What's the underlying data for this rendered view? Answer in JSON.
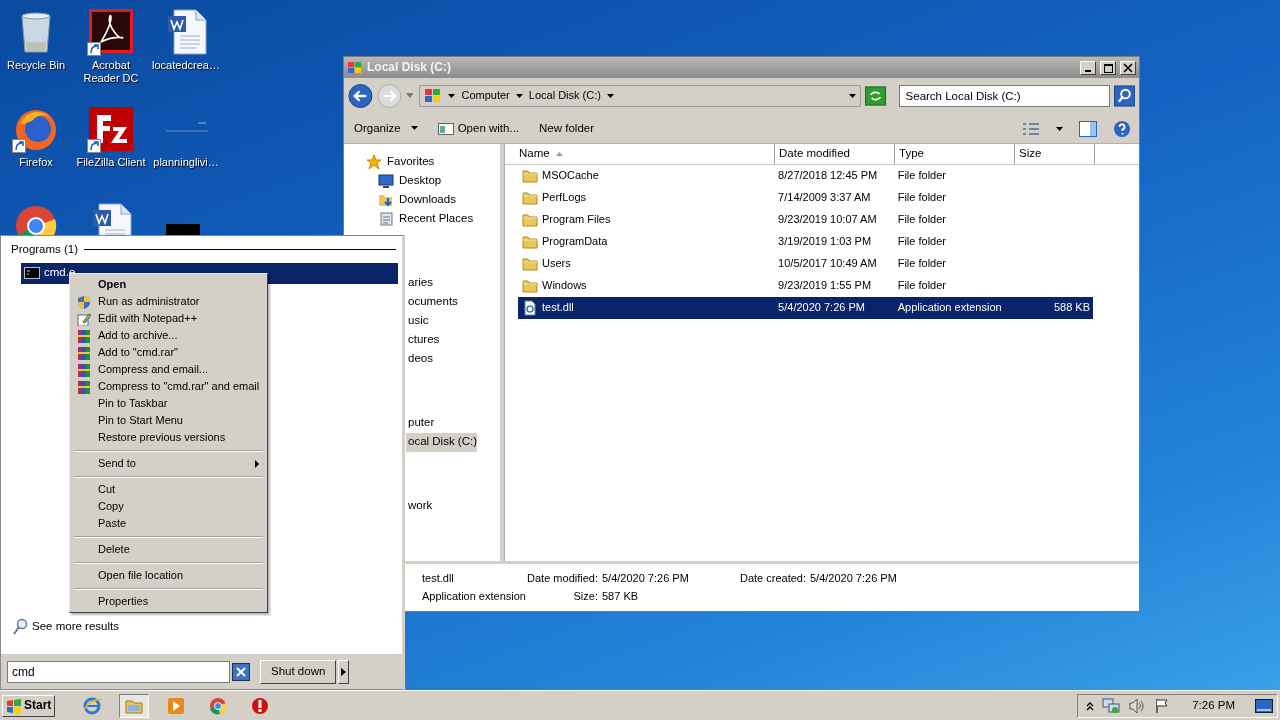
{
  "desktop_icons": [
    {
      "label": "Recycle Bin",
      "kind": "recycle",
      "shortcut": false
    },
    {
      "label": "Acrobat Reader DC",
      "kind": "acrobat",
      "shortcut": true
    },
    {
      "label": "locatedcrea…",
      "kind": "word",
      "shortcut": false
    },
    {
      "label": "Firefox",
      "kind": "firefox",
      "shortcut": true
    },
    {
      "label": "FileZilla Client",
      "kind": "filezilla",
      "shortcut": true
    },
    {
      "label": "planninglivi…",
      "kind": "blank",
      "shortcut": false
    },
    {
      "kind": "chrome",
      "shortcut": false
    },
    {
      "kind": "word",
      "shortcut": false
    },
    {
      "kind": "dark",
      "shortcut": false
    }
  ],
  "explorer": {
    "title": "Local Disk (C:)",
    "breadcrumb": [
      "Computer",
      "Local Disk (C:)"
    ],
    "search": {
      "placeholder": "Search Local Disk (C:)"
    },
    "toolbar": [
      {
        "label": "Organize",
        "kind": "menu"
      },
      {
        "label": "Open with...",
        "kind": "open"
      },
      {
        "label": "New folder",
        "kind": "plain"
      }
    ],
    "nav_pane": {
      "groups": [
        {
          "items": [
            {
              "label": "Favorites",
              "kind": "star",
              "selected": false
            },
            {
              "label": "Desktop",
              "kind": "desktop",
              "selected": false
            },
            {
              "label": "Downloads",
              "kind": "downloads",
              "selected": false
            },
            {
              "label": "Recent Places",
              "kind": "recent",
              "selected": false
            }
          ]
        },
        {
          "items": [
            {
              "label": "aries",
              "kind": "covered",
              "selected": false
            },
            {
              "label": "ocuments",
              "kind": "covered",
              "selected": false
            },
            {
              "label": "usic",
              "kind": "covered",
              "selected": false
            },
            {
              "label": "ctures",
              "kind": "covered",
              "selected": false
            },
            {
              "label": "deos",
              "kind": "covered",
              "selected": false
            }
          ]
        },
        {
          "items": [
            {
              "label": "puter",
              "kind": "covered",
              "selected": false
            },
            {
              "label": "ocal Disk (C:)",
              "kind": "covered",
              "selected": true
            }
          ]
        },
        {
          "items": [
            {
              "label": "work",
              "kind": "covered",
              "selected": false
            }
          ]
        }
      ]
    },
    "columns": [
      {
        "label": "Name",
        "sorted": true
      },
      {
        "label": "Date modified",
        "sorted": false
      },
      {
        "label": "Type",
        "sorted": false
      },
      {
        "label": "Size",
        "sorted": false
      }
    ],
    "rows": [
      {
        "name": "MSOCache",
        "date": "8/27/2018 12:45 PM",
        "type": "File folder",
        "kind": "folder",
        "selected": false
      },
      {
        "name": "PerfLogs",
        "date": "7/14/2009 3:37 AM",
        "type": "File folder",
        "kind": "folder",
        "selected": false
      },
      {
        "name": "Program Files",
        "date": "9/23/2019 10:07 AM",
        "type": "File folder",
        "kind": "folder",
        "selected": false
      },
      {
        "name": "ProgramData",
        "date": "3/19/2019 1:03 PM",
        "type": "File folder",
        "kind": "folder",
        "selected": false
      },
      {
        "name": "Users",
        "date": "10/5/2017 10:49 AM",
        "type": "File folder",
        "kind": "folder",
        "selected": false
      },
      {
        "name": "Windows",
        "date": "9/23/2019 1:55 PM",
        "type": "File folder",
        "kind": "folder",
        "selected": false
      },
      {
        "name": "test.dll",
        "date": "5/4/2020 7:26 PM",
        "type": "Application extension",
        "size": "588 KB",
        "kind": "dll",
        "selected": true
      }
    ],
    "details": {
      "name": "test.dll",
      "type": "Application extension",
      "fields": [
        {
          "label": "Date modified:",
          "value": "5/4/2020 7:26 PM"
        },
        {
          "label": "Date created:",
          "value": "5/4/2020 7:26 PM"
        },
        {
          "label": "Size:",
          "value": "587 KB"
        }
      ]
    }
  },
  "start_menu": {
    "section": "Programs (1)",
    "results": [
      {
        "label": "cmd.e",
        "selected": true
      }
    ],
    "more": "See more results",
    "search": {
      "value": "cmd"
    },
    "shutdown": "Shut down"
  },
  "context_menu": {
    "items": [
      {
        "label": "Open",
        "kind": "default"
      },
      {
        "label": "Run as administrator",
        "kind": "shield"
      },
      {
        "label": "Edit with Notepad++",
        "kind": "notepad"
      },
      {
        "label": "Add to archive...",
        "kind": "archive"
      },
      {
        "label": "Add to \"cmd.rar\"",
        "kind": "archive"
      },
      {
        "label": "Compress and email...",
        "kind": "archive"
      },
      {
        "label": "Compress to \"cmd.rar\" and email",
        "kind": "archive"
      },
      {
        "label": "Pin to Taskbar",
        "kind": "plain"
      },
      {
        "label": "Pin to Start Menu",
        "kind": "plain"
      },
      {
        "label": "Restore previous versions",
        "kind": "plain"
      },
      {
        "kind": "separator"
      },
      {
        "label": "Send to",
        "kind": "submenu"
      },
      {
        "kind": "separator"
      },
      {
        "label": "Cut",
        "kind": "plain"
      },
      {
        "label": "Copy",
        "kind": "plain"
      },
      {
        "label": "Paste",
        "kind": "plain"
      },
      {
        "kind": "separator"
      },
      {
        "label": "Delete",
        "kind": "plain"
      },
      {
        "kind": "separator"
      },
      {
        "label": "Open file location",
        "kind": "plain"
      },
      {
        "kind": "separator"
      },
      {
        "label": "Properties",
        "kind": "plain"
      }
    ]
  },
  "taskbar": {
    "start": "Start",
    "apps": [
      {
        "kind": "ie",
        "selected": false
      },
      {
        "kind": "explorer",
        "selected": true
      },
      {
        "kind": "media",
        "selected": false
      },
      {
        "kind": "chrome",
        "selected": false
      },
      {
        "kind": "stop",
        "selected": false
      }
    ],
    "clock": "7:26 PM"
  }
}
